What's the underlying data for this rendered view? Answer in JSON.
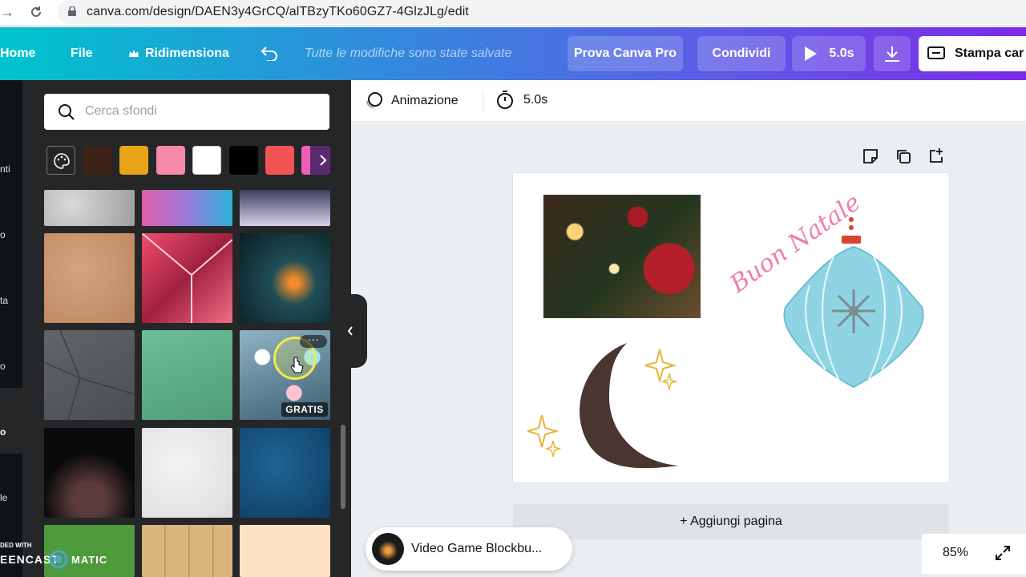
{
  "browser": {
    "url": "canva.com/design/DAEN3y4GrCQ/alTBzyTKo60GZ7-4GlzJLg/edit"
  },
  "toolbar": {
    "home": "Home",
    "file": "File",
    "resize": "Ridimensiona",
    "save_status": "Tutte le modifiche sono state salvate",
    "try_pro": "Prova Canva Pro",
    "share": "Condividi",
    "duration": "5.0s",
    "print": "Stampa car"
  },
  "rail": {
    "labels": [
      "nti",
      "o",
      "ta",
      "o",
      "o",
      "le"
    ]
  },
  "panel": {
    "search_placeholder": "Cerca sfondi",
    "swatches": [
      "#3b2318",
      "#e8a317",
      "#f48aa8",
      "#ffffff",
      "#000000",
      "#f25353",
      "#ef5fb5"
    ],
    "badge_free": "GRATIS"
  },
  "editor": {
    "animation": "Animazione",
    "duration": "5.0s",
    "add_page": "+ Aggiungi pagina",
    "zoom": "85%",
    "design_text": "Buon Natale"
  },
  "toast": {
    "title": "Video Game Blockbu..."
  },
  "watermark": {
    "line1": "DED WITH",
    "line2": "EENCAST",
    "line3": "MATIC"
  }
}
